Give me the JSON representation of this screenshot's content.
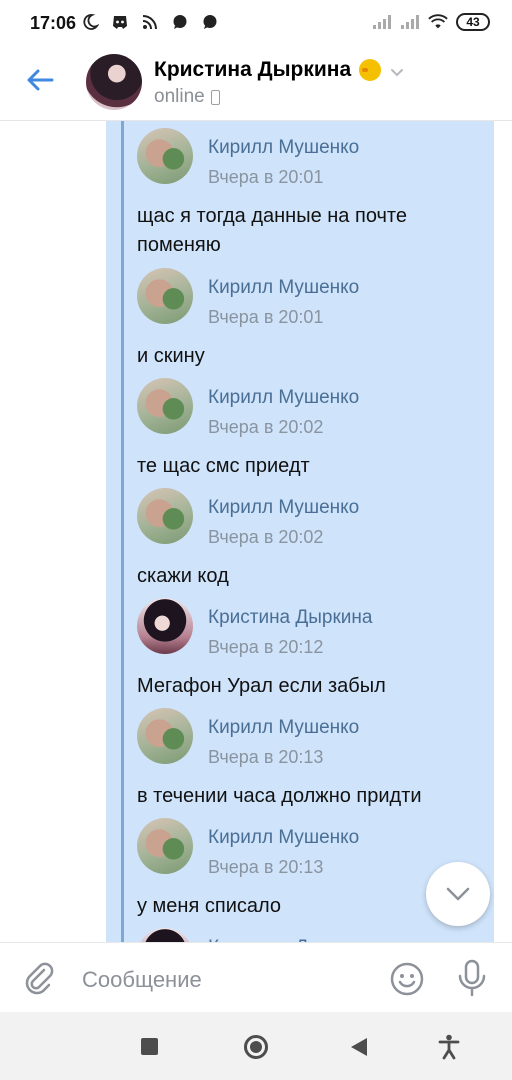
{
  "status_bar": {
    "time": "17:06",
    "battery": "43",
    "left_icons": [
      "moon-icon",
      "discord-icon",
      "rss-icon",
      "chat-bubble-icon",
      "chat-bubble-icon"
    ],
    "right_icons": [
      "signal-icon",
      "signal-icon",
      "wifi-icon",
      "battery-icon"
    ]
  },
  "header": {
    "name": "Кристина Дыркина",
    "status": "online"
  },
  "messages": [
    {
      "author": "Кирилл Мушенко",
      "time": "Вчера в 20:01",
      "text": "щас я тогда данные на почте поменяю",
      "avatar": "kirill"
    },
    {
      "author": "Кирилл Мушенко",
      "time": "Вчера в 20:01",
      "text": "и скину",
      "avatar": "kirill"
    },
    {
      "author": "Кирилл Мушенко",
      "time": "Вчера в 20:02",
      "text": "те щас смс приедт",
      "avatar": "kirill"
    },
    {
      "author": "Кирилл Мушенко",
      "time": "Вчера в 20:02",
      "text": "скажи код",
      "avatar": "kirill"
    },
    {
      "author": "Кристина Дыркина",
      "time": "Вчера в 20:12",
      "text": "Мегафон Урал если забыл",
      "avatar": "kristina"
    },
    {
      "author": "Кирилл Мушенко",
      "time": "Вчера в 20:13",
      "text": "в течении часа должно придти",
      "avatar": "kirill"
    },
    {
      "author": "Кирилл Мушенко",
      "time": "Вчера в 20:13",
      "text": "у меня списало",
      "avatar": "kirill"
    },
    {
      "author": "Кристина Дыркина",
      "time": "",
      "text": "",
      "avatar": "kristina"
    }
  ],
  "composer": {
    "placeholder": "Сообщение"
  },
  "colors": {
    "forward_bg": "#cfe3fa",
    "forward_line": "#7ea6d6",
    "author": "#4a6f96",
    "accent": "#3f8ae0"
  }
}
